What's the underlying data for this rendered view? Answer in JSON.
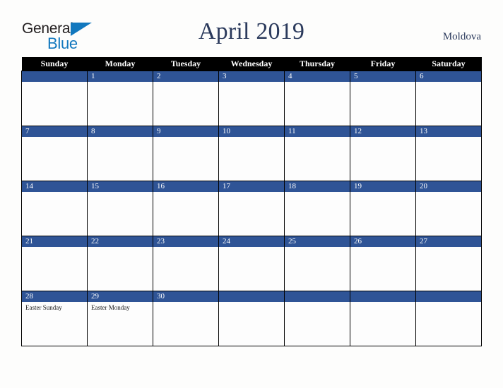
{
  "brand": {
    "name_part1": "General",
    "name_part2": "Blue",
    "triangle_icon": "triangle-icon",
    "color_dark": "#231f20",
    "color_blue": "#1278be"
  },
  "header": {
    "title": "April 2019",
    "region": "Moldova",
    "title_color": "#2b3a5c"
  },
  "calendar": {
    "weekday_headers": [
      "Sunday",
      "Monday",
      "Tuesday",
      "Wednesday",
      "Thursday",
      "Friday",
      "Saturday"
    ],
    "header_bg": "#000000",
    "daynum_bg": "#2f5496",
    "cell_bg": "#fdfdfd",
    "weeks": [
      [
        {
          "day": "",
          "events": []
        },
        {
          "day": "1",
          "events": []
        },
        {
          "day": "2",
          "events": []
        },
        {
          "day": "3",
          "events": []
        },
        {
          "day": "4",
          "events": []
        },
        {
          "day": "5",
          "events": []
        },
        {
          "day": "6",
          "events": []
        }
      ],
      [
        {
          "day": "7",
          "events": []
        },
        {
          "day": "8",
          "events": []
        },
        {
          "day": "9",
          "events": []
        },
        {
          "day": "10",
          "events": []
        },
        {
          "day": "11",
          "events": []
        },
        {
          "day": "12",
          "events": []
        },
        {
          "day": "13",
          "events": []
        }
      ],
      [
        {
          "day": "14",
          "events": []
        },
        {
          "day": "15",
          "events": []
        },
        {
          "day": "16",
          "events": []
        },
        {
          "day": "17",
          "events": []
        },
        {
          "day": "18",
          "events": []
        },
        {
          "day": "19",
          "events": []
        },
        {
          "day": "20",
          "events": []
        }
      ],
      [
        {
          "day": "21",
          "events": []
        },
        {
          "day": "22",
          "events": []
        },
        {
          "day": "23",
          "events": []
        },
        {
          "day": "24",
          "events": []
        },
        {
          "day": "25",
          "events": []
        },
        {
          "day": "26",
          "events": []
        },
        {
          "day": "27",
          "events": []
        }
      ],
      [
        {
          "day": "28",
          "events": [
            "Easter Sunday"
          ]
        },
        {
          "day": "29",
          "events": [
            "Easter Monday"
          ]
        },
        {
          "day": "30",
          "events": []
        },
        {
          "day": "",
          "events": []
        },
        {
          "day": "",
          "events": []
        },
        {
          "day": "",
          "events": []
        },
        {
          "day": "",
          "events": []
        }
      ]
    ]
  }
}
